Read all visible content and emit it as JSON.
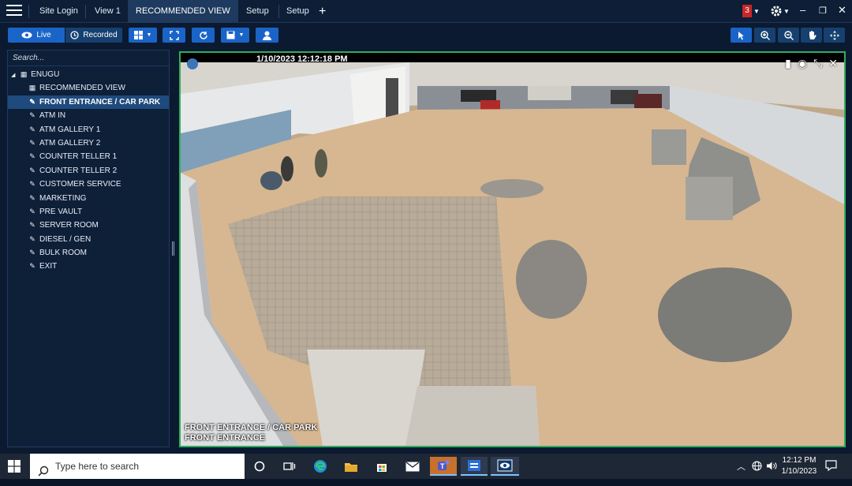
{
  "tabs": [
    {
      "label": "Site Login"
    },
    {
      "label": "View 1"
    },
    {
      "label": "RECOMMENDED VIEW",
      "close": "✕"
    },
    {
      "label": "Setup"
    },
    {
      "label": "Setup"
    }
  ],
  "header": {
    "alert_count": "3",
    "add_tab": "+"
  },
  "toolbar": {
    "live_label": "Live",
    "recorded_label": "Recorded"
  },
  "sidebar": {
    "search_placeholder": "Search...",
    "root": "ENUGU",
    "items": [
      {
        "label": "RECOMMENDED VIEW",
        "icon": "grid-icon"
      },
      {
        "label": "FRONT ENTRANCE / CAR PARK",
        "icon": "camera-icon",
        "selected": true
      },
      {
        "label": "ATM IN",
        "icon": "camera-icon"
      },
      {
        "label": "ATM GALLERY 1",
        "icon": "camera-icon"
      },
      {
        "label": "ATM GALLERY 2",
        "icon": "camera-icon"
      },
      {
        "label": "COUNTER TELLER 1",
        "icon": "camera-icon"
      },
      {
        "label": "COUNTER TELLER 2",
        "icon": "camera-icon"
      },
      {
        "label": "CUSTOMER SERVICE",
        "icon": "camera-icon"
      },
      {
        "label": "MARKETING",
        "icon": "camera-icon"
      },
      {
        "label": "PRE VAULT",
        "icon": "camera-icon"
      },
      {
        "label": "SERVER ROOM",
        "icon": "camera-icon"
      },
      {
        "label": "DIESEL / GEN",
        "icon": "camera-icon"
      },
      {
        "label": "BULK ROOM",
        "icon": "camera-icon"
      },
      {
        "label": "EXIT",
        "icon": "camera-icon"
      }
    ]
  },
  "video": {
    "timestamp": "1/10/2023 12:12:18 PM",
    "camera_name": "FRONT ENTRANCE / CAR PARK",
    "location_label": "FRONT ENTRANCE",
    "border_color": "#2fae5c"
  },
  "taskbar": {
    "search_placeholder": "Type here to search",
    "time": "12:12 PM",
    "date": "1/10/2023"
  },
  "colors": {
    "accent": "#1a64c8",
    "alert": "#c62828",
    "selected": "#1f4a7d"
  }
}
